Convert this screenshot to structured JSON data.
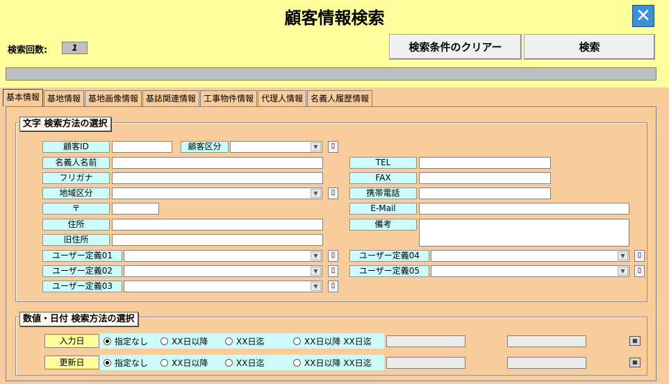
{
  "header": {
    "title": "顧客情報検索",
    "count_label": "検索回数:",
    "count_value": "1",
    "clear_label": "検索条件のクリアー",
    "search_label": "検索"
  },
  "tabs": [
    {
      "label": "基本情報"
    },
    {
      "label": "基地情報"
    },
    {
      "label": "基地画像情報"
    },
    {
      "label": "基誌関連情報"
    },
    {
      "label": "工事物件情報"
    },
    {
      "label": "代理人情報"
    },
    {
      "label": "名義人履歴情報"
    }
  ],
  "text_section": {
    "title": "文字 検索方法の選択",
    "customer_id": "顧客ID",
    "customer_type": "顧客区分",
    "name": "名義人名前",
    "furigana": "フリガナ",
    "region": "地域区分",
    "postal": "〒",
    "address": "住所",
    "old_address": "旧住所",
    "user1": "ユーザー定義01",
    "user2": "ユーザー定義02",
    "user3": "ユーザー定義03",
    "tel": "TEL",
    "fax": "FAX",
    "mobile": "携帯電話",
    "email": "E-Mail",
    "note": "備考",
    "user4": "ユーザー定義04",
    "user5": "ユーザー定義05"
  },
  "date_section": {
    "title": "数値・日付 検索方法の選択",
    "rows": [
      {
        "label": "入力日"
      },
      {
        "label": "更新日"
      }
    ],
    "options": [
      "指定なし",
      "XX日以降",
      "XX日迄",
      "XX日以降 XX日迄"
    ],
    "selected_option": "指定なし"
  }
}
